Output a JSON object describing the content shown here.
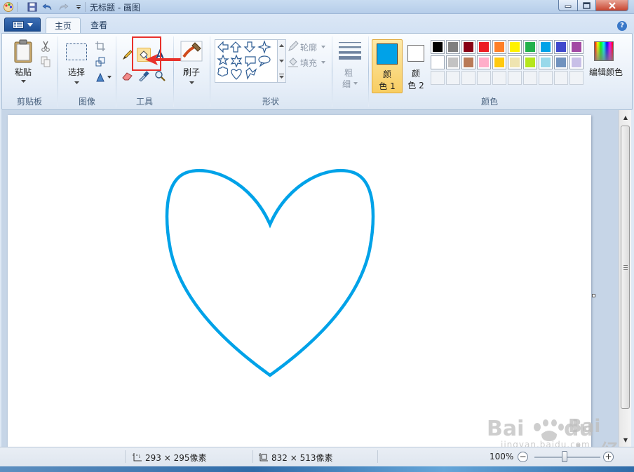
{
  "window": {
    "title": "无标题 - 画图"
  },
  "tabs": {
    "home": "主页",
    "view": "查看"
  },
  "ribbon": {
    "clipboard": {
      "paste_label": "粘贴",
      "group_label": "剪贴板"
    },
    "image": {
      "select_label": "选择",
      "group_label": "图像"
    },
    "tools": {
      "group_label": "工具",
      "highlighted_tool": "fill-with-color",
      "highlight_color": "#e8312b"
    },
    "brushes": {
      "label": "刷子"
    },
    "shapes": {
      "group_label": "形状",
      "outline_label": "轮廓",
      "fill_label": "填充"
    },
    "size": {
      "label_line1": "粗",
      "label_line2": "细"
    },
    "colors": {
      "group_label": "颜色",
      "color1_line1": "颜",
      "color1_line2": "色 1",
      "color2_line1": "颜",
      "color2_line2": "色 2",
      "color1_value": "#00a2e8",
      "color2_value": "#ffffff",
      "edit_colors_label": "编辑颜色",
      "palette_row1": [
        "#000000",
        "#7f7f7f",
        "#880015",
        "#ed1c24",
        "#ff7f27",
        "#fff200",
        "#22b14c",
        "#00a2e8",
        "#3f48cc",
        "#a349a4"
      ],
      "palette_row2": [
        "#ffffff",
        "#c3c3c3",
        "#b97a57",
        "#ffaec9",
        "#ffc90e",
        "#efe4b0",
        "#b5e61d",
        "#99d9ea",
        "#7092be",
        "#c8bfe7"
      ]
    }
  },
  "canvas": {
    "shape": "heart-outline",
    "stroke_color": "#00a2e8"
  },
  "statusbar": {
    "cursor_position": "293 × 295像素",
    "canvas_size": "832 × 513像素",
    "zoom": "100%"
  },
  "watermark": {
    "brand": "Bai du 经验",
    "site": "jingyan.baidu.com"
  }
}
